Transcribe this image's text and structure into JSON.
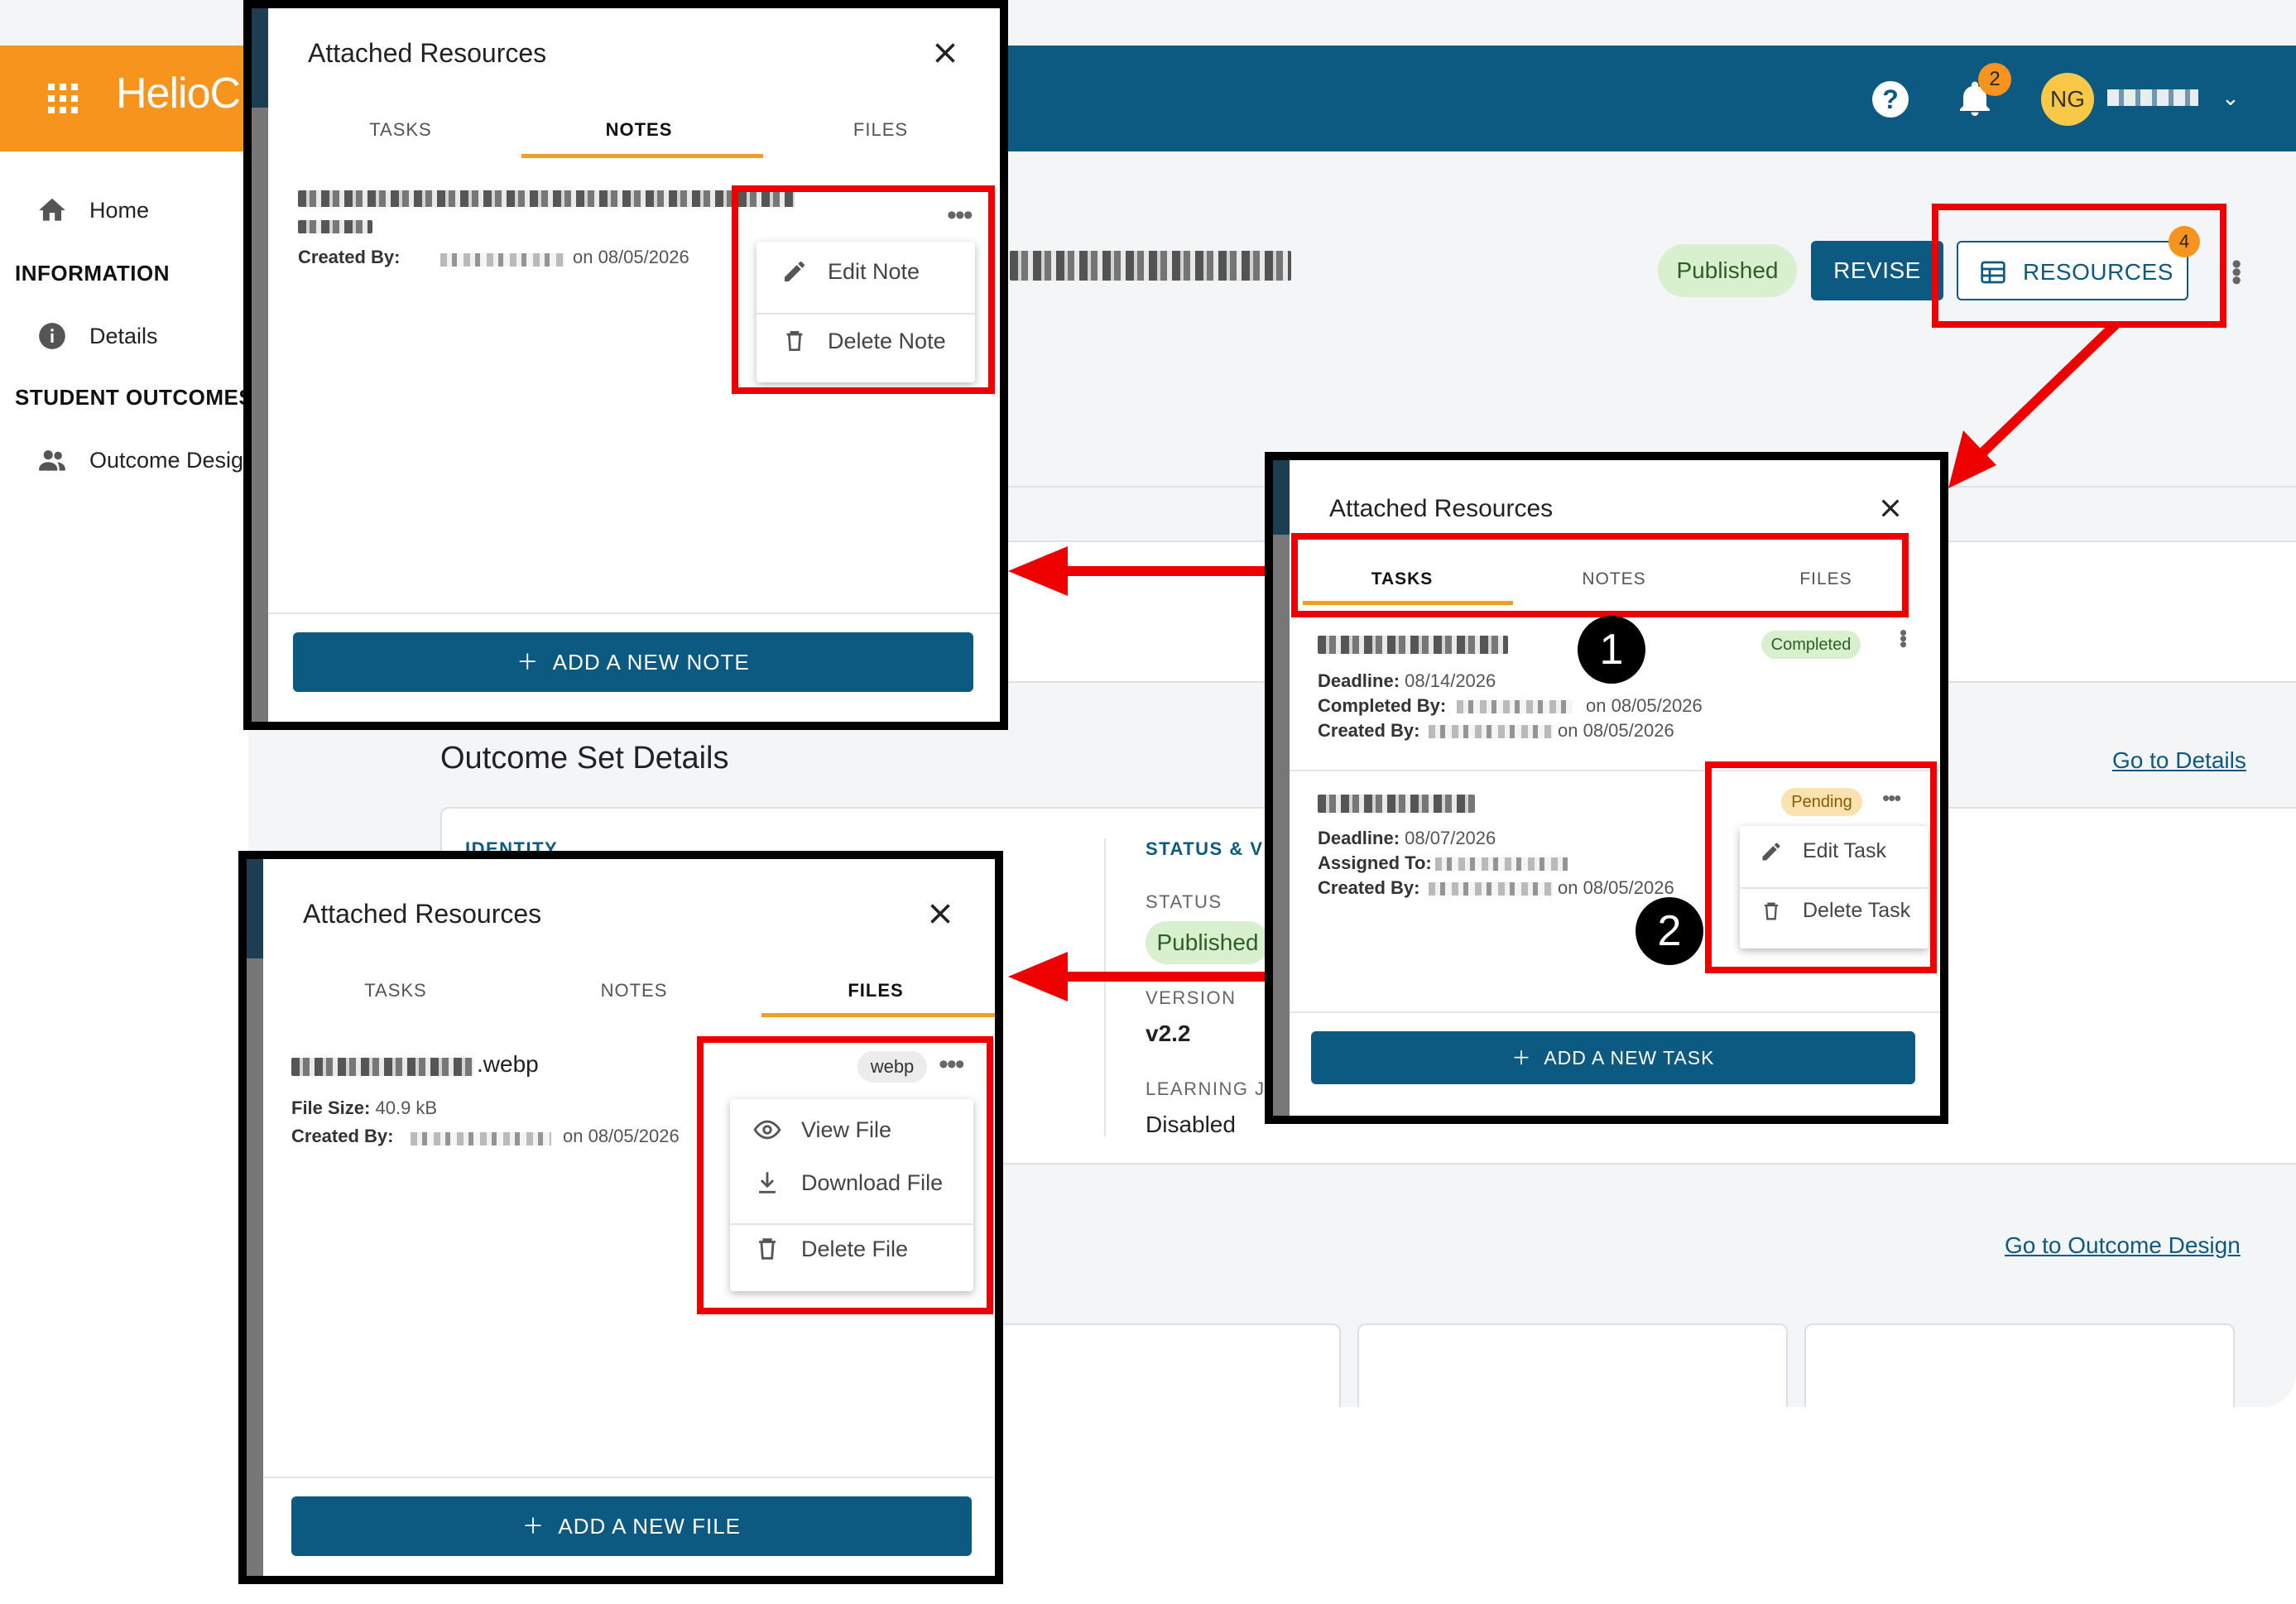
{
  "app": {
    "brand": "HelioC",
    "notifications_count": "2",
    "user_initials": "NG",
    "help_symbol": "?"
  },
  "sidebar": {
    "home": "Home",
    "section_information": "INFORMATION",
    "details": "Details",
    "section_student_outcomes": "STUDENT OUTCOMES",
    "outcome_design": "Outcome Design"
  },
  "header": {
    "status": "Published",
    "revise": "REVISE",
    "resources": "RESOURCES",
    "resources_count": "4"
  },
  "main": {
    "outcome_set_details": "Outcome Set Details",
    "go_to_details": "Go to Details",
    "identity": "IDENTITY",
    "status_section": "STATUS & V",
    "status_label": "STATUS",
    "status_value": "Published",
    "version_label": "VERSION",
    "version_value": "v2.2",
    "learning_label": "LEARNING JO",
    "learning_value": "Disabled",
    "go_to_outcome_design": "Go to Outcome Design"
  },
  "panel_common": {
    "title": "Attached Resources",
    "tab_tasks": "TASKS",
    "tab_notes": "NOTES",
    "tab_files": "FILES"
  },
  "notes_panel": {
    "created_by_label": "Created By:",
    "created_on": "on 08/05/2026",
    "menu_edit": "Edit Note",
    "menu_delete": "Delete Note",
    "add_button": "ADD A NEW NOTE"
  },
  "tasks_panel": {
    "task1": {
      "status": "Completed",
      "deadline_label": "Deadline:",
      "deadline": "08/14/2026",
      "completed_by_label": "Completed By:",
      "completed_on": "on 08/05/2026",
      "created_by_label": "Created By:",
      "created_on": "on 08/05/2026"
    },
    "task2": {
      "status": "Pending",
      "deadline_label": "Deadline:",
      "deadline": "08/07/2026",
      "assigned_to_label": "Assigned To:",
      "created_by_label": "Created By:",
      "created_on": "on 08/05/2026"
    },
    "menu_edit": "Edit Task",
    "menu_delete": "Delete Task",
    "add_button": "ADD A NEW TASK"
  },
  "files_panel": {
    "file_name_suffix": ".webp",
    "file_type": "webp",
    "file_size_label": "File Size:",
    "file_size": "40.9 kB",
    "created_by_label": "Created By:",
    "created_on": "on 08/05/2026",
    "menu_view": "View File",
    "menu_download": "Download File",
    "menu_delete": "Delete File",
    "add_button": "ADD A NEW FILE"
  },
  "annotations": {
    "step1": "1",
    "step2": "2"
  },
  "colors": {
    "brand_orange": "#f7941d",
    "brand_blue": "#0c5a82",
    "annotation_red": "#ee0000",
    "tab_indicator": "#f0a020"
  }
}
